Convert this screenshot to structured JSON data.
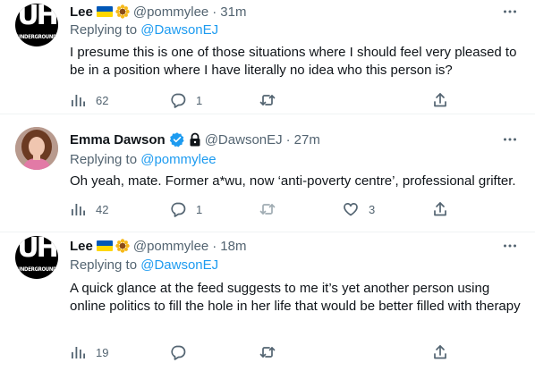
{
  "tweets": [
    {
      "name": "Lee",
      "handle": "@pommylee",
      "time": "31m",
      "reply_prefix": "Replying to ",
      "reply_to": "@DawsonEJ",
      "text": "I presume this is one of those situations where I should feel very pleased to be in a position where I have literally no idea who this person is?",
      "avatar_text": "UH",
      "avatar_subtext": "UNDERGROUND",
      "views": "62",
      "replies": "1",
      "retweets": "",
      "likes": ""
    },
    {
      "name": "Emma Dawson",
      "handle": "@DawsonEJ",
      "time": "27m",
      "reply_prefix": "Replying to ",
      "reply_to": "@pommylee",
      "text": "Oh yeah, mate. Former a*wu, now ‘anti-poverty centre’, professional grifter.",
      "views": "42",
      "replies": "1",
      "retweets": "",
      "likes": "3"
    },
    {
      "name": "Lee",
      "handle": "@pommylee",
      "time": "18m",
      "reply_prefix": "Replying to ",
      "reply_to": "@DawsonEJ",
      "text": "A quick glance at the feed suggests to me it’s yet another person using online politics to fill the hole in her life that would be better filled with therapy",
      "avatar_text": "UH",
      "avatar_subtext": "UNDERGROUND",
      "views": "19",
      "replies": "",
      "retweets": "",
      "likes": ""
    }
  ],
  "separator": "·",
  "colors": {
    "text": "#0f1419",
    "muted": "#536471",
    "link": "#1d9bf0",
    "divider": "#eff3f4",
    "flag_blue": "#0057b7",
    "flag_yellow": "#ffd700"
  },
  "icons": [
    "views-icon",
    "reply-icon",
    "retweet-icon",
    "like-icon",
    "share-icon",
    "more-icon",
    "verified-badge-icon",
    "lock-icon",
    "ukraine-flag-icon",
    "sunflower-icon"
  ]
}
